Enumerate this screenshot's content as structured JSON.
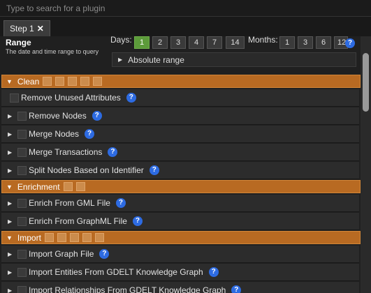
{
  "search": {
    "placeholder": "Type to search for a plugin"
  },
  "tabs": [
    {
      "label": "Step 1",
      "close_glyph": "✕"
    }
  ],
  "range": {
    "title": "Range",
    "subtitle": "The date and time range to query",
    "days_label": "Days:",
    "days": [
      "1",
      "2",
      "3",
      "4",
      "7",
      "14"
    ],
    "days_selected": "1",
    "months_label": "Months:",
    "months": [
      "1",
      "3",
      "6",
      "12"
    ],
    "help_glyph": "?",
    "absolute_range_label": "Absolute range"
  },
  "accent_colors": {
    "section": "#b86a22",
    "help": "#2d6be2",
    "selected_day": "#5c9b3a"
  },
  "sections": [
    {
      "name": "Clean",
      "items": [
        {
          "label": "Remove Unused Attributes",
          "expandable": false
        },
        {
          "label": "Remove Nodes",
          "expandable": true
        },
        {
          "label": "Merge Nodes",
          "expandable": true
        },
        {
          "label": "Merge Transactions",
          "expandable": true
        },
        {
          "label": "Split Nodes Based on Identifier",
          "expandable": true
        }
      ]
    },
    {
      "name": "Enrichment",
      "items": [
        {
          "label": "Enrich From GML File",
          "expandable": true
        },
        {
          "label": "Enrich From GraphML File",
          "expandable": true
        }
      ]
    },
    {
      "name": "Import",
      "items": [
        {
          "label": "Import Graph File",
          "expandable": true
        },
        {
          "label": "Import Entities From GDELT Knowledge Graph",
          "expandable": true
        },
        {
          "label": "Import Relationships From GDELT Knowledge Graph",
          "expandable": true
        }
      ]
    }
  ]
}
